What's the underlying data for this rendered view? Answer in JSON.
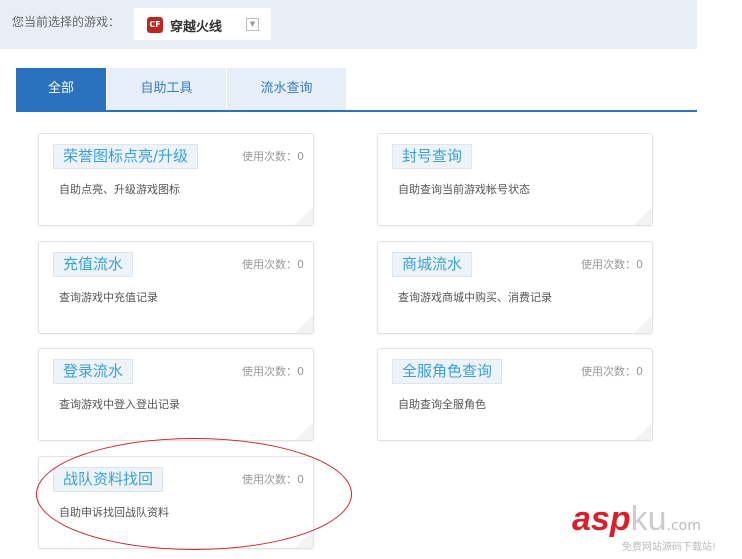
{
  "header": {
    "label": "您当前选择的游戏：",
    "game_icon": "CF",
    "game_name": "穿越火线"
  },
  "tabs": [
    "全部",
    "自助工具",
    "流水查询"
  ],
  "cards": [
    {
      "title": "荣誉图标点亮/升级",
      "usage": "使用次数：0",
      "desc": "自助点亮、升级游戏图标"
    },
    {
      "title": "封号查询",
      "usage": "",
      "desc": "自助查询当前游戏帐号状态"
    },
    {
      "title": "充值流水",
      "usage": "使用次数：0",
      "desc": "查询游戏中充值记录"
    },
    {
      "title": "商城流水",
      "usage": "使用次数：0",
      "desc": "查询游戏商城中购买、消费记录"
    },
    {
      "title": "登录流水",
      "usage": "使用次数：0",
      "desc": "查询游戏中登入登出记录"
    },
    {
      "title": "全服角色查询",
      "usage": "使用次数：0",
      "desc": "自助查询全服角色"
    },
    {
      "title": "战队资料找回",
      "usage": "使用次数：0",
      "desc": "自助申诉找回战队资料"
    }
  ],
  "watermark": {
    "a": "asp",
    "k": "ku",
    "c": ".com",
    "slogan": "免费网站源码下载站!"
  }
}
